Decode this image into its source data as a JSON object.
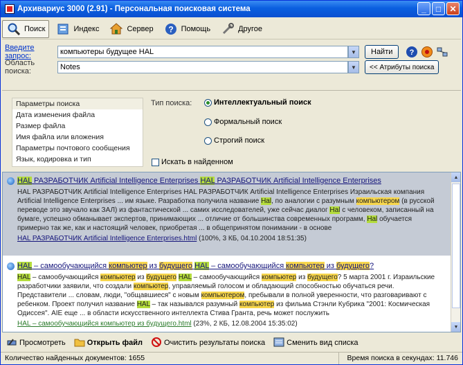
{
  "window": {
    "title": "Архивариус 3000 (2.91) - Персональная поисковая система",
    "min_label": "_",
    "max_label": "□",
    "close_label": "✕"
  },
  "toolbar": {
    "items": [
      {
        "label": "Поиск",
        "icon": "search-icon"
      },
      {
        "label": "Индекс",
        "icon": "index-icon"
      },
      {
        "label": "Сервер",
        "icon": "server-icon"
      },
      {
        "label": "Помощь",
        "icon": "help-icon"
      },
      {
        "label": "Другое",
        "icon": "tools-icon"
      }
    ]
  },
  "query": {
    "label": "Введите запрос:",
    "value": "компьютеры будущее HAL",
    "find_button": "Найти"
  },
  "area": {
    "label": "Область поиска:",
    "value": "Notes",
    "attributes_button": "<< Атрибуты поиска"
  },
  "params": {
    "items": [
      "Параметры поиска",
      "Дата изменения файла",
      "Размер файла",
      "Имя файла или вложения",
      "Параметры почтового сообщения",
      "Язык, кодировка и тип"
    ],
    "search_type_label": "Тип поиска:",
    "radio_intellectual": "Интеллектуальный поиск",
    "radio_formal": "Формальный поиск",
    "radio_strict": "Строгий поиск",
    "search_in_found": "Искать в найденном"
  },
  "results": [
    {
      "title_pre": "",
      "hal1": "HAL",
      "title_mid": " РАЗРАБОТЧИК Artificial Intelligence Enterprises ",
      "hal2": "HAL",
      "title_post": " РАЗРАБОТЧИК Artificial Intelligence Enterprises",
      "body_1": "HAL РАЗРАБОТЧИК Artificial Intelligence Enterprises HAL РАЗРАБОТЧИК Artificial Intelligence Enterprises Израильская компания Artificial Intelligence Enterprises ... им языке. Разработка получила название ",
      "body_hal": "Hal",
      "body_2": ", по аналогии с разумным ",
      "body_comp": "компьютером",
      "body_3": " (в русской переводе это звучало как ЗАЛ) из фантастической ... самих исследователей, уже сейчас диалог ",
      "body_hal2": "Hal",
      "body_4": " с человеком, записанный на бумаге, успешно обманывает экспертов, принимающих ... отличие от большинства современных программ, ",
      "body_hal3": "Hal",
      "body_5": " обучается примерно так же, как и настоящий человек, приобретая ... в общепринятом понимании - в основе",
      "file": "HAL РАЗРАБОТЧИК Artificial Intelligence Enterprises.html",
      "meta": "(100%, 3 КБ, 04.10.2004 18:51:35)"
    },
    {
      "t_hal": "HAL",
      "t_a": " – самообучающийся ",
      "t_comp": "компьютер",
      "t_b": " из ",
      "t_fut": "будущего",
      "t_c": " ",
      "t_hal2": "HAL",
      "t_d": " – самообучающийся ",
      "t_comp2": "компьютер",
      "t_e": " из ",
      "t_fut2": "будущего",
      "t_f": "?",
      "b_hal": "HAL",
      "b_a": " – самообучающийся ",
      "b_comp": "компьютер",
      "b_b": " из ",
      "b_fut": "будущего",
      "b_c": " ",
      "b_hal2": "HAL",
      "b_d": " – самообучающийся ",
      "b_comp2": "компьютер",
      "b_e": " из ",
      "b_fut2": "будущего",
      "b_f": "? 5 марта 2001 г. Израильские разработчики заявили, что создали ",
      "b_comp3": "компьютер",
      "b_g": ", управляемый голосом и обладающий способностью обучаться речи. Представители ... словам, люди, \"общавшиеся\" с новым ",
      "b_comp4": "компьютером",
      "b_h": ", пребывали в полной уверенности, что разговаривают с ребенком. Проект получил название ",
      "b_hal3": "HAL",
      "b_i": " – так назывался разумный ",
      "b_comp5": "компьютер",
      "b_j": " из фильма Стэнли Кубрика \"2001: Космическая Одиссея\". AIE еще ... в области искусственного интеллекта Стива Гранта, речь может послужить",
      "file": "HAL – самообучающийся компьютер из будущего.html",
      "meta": "(23%, 2 КБ, 12.08.2004 15:35:02)"
    }
  ],
  "bottom_toolbar": {
    "view": "Просмотреть",
    "open": "Открыть файл",
    "clear": "Очистить результаты поиска",
    "change_view": "Сменить вид списка"
  },
  "status": {
    "found": "Количество найденных документов: 1655",
    "time": "Время поиска в секундах: 11.746"
  }
}
